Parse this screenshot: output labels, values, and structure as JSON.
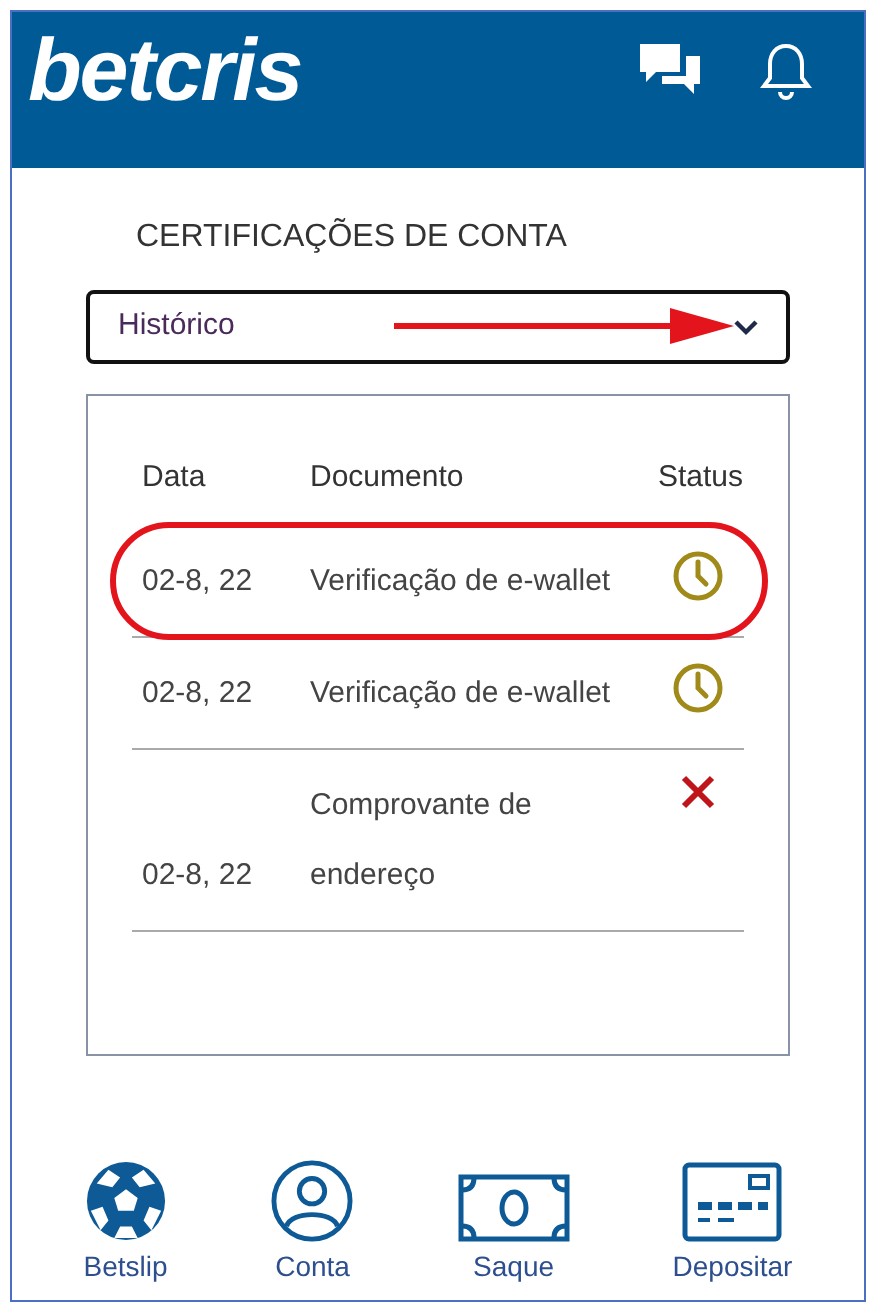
{
  "header": {
    "logo": "betcris"
  },
  "title": "CERTIFICAÇÕES DE CONTA",
  "select": {
    "value": "Histórico",
    "annotated": true
  },
  "table": {
    "columns": [
      "Data",
      "Documento",
      "Status"
    ],
    "rows": [
      {
        "date": "02-8, 22",
        "document": "Verificação de e-wallet",
        "kind": "pending",
        "highlighted": true
      },
      {
        "date": "02-8, 22",
        "document": "Verificação de e-wallet",
        "kind": "pending",
        "highlighted": false
      },
      {
        "date": "02-8, 22",
        "document": "Comprovante de endereço",
        "kind": "rejected",
        "highlighted": false
      }
    ]
  },
  "nav": [
    {
      "label": "Betslip",
      "kind": "ball"
    },
    {
      "label": "Conta",
      "kind": "user"
    },
    {
      "label": "Saque",
      "kind": "cash"
    },
    {
      "label": "Depositar",
      "kind": "card"
    }
  ]
}
